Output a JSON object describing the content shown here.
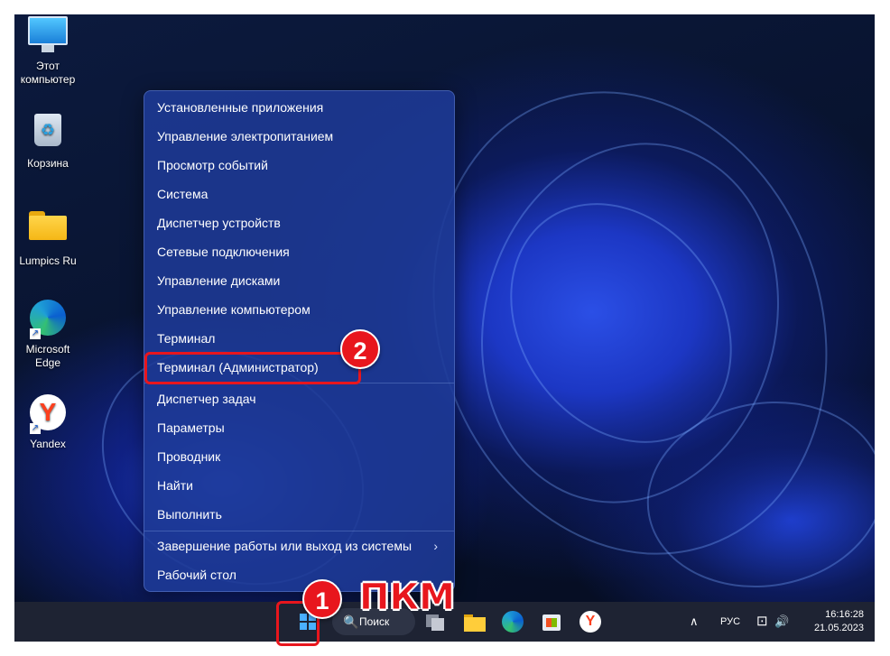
{
  "desktop": {
    "icons": [
      {
        "label_line1": "Этот",
        "label_line2": "компьютер",
        "icon": "this-pc-icon"
      },
      {
        "label_line1": "Корзина",
        "label_line2": "",
        "icon": "recycle-bin-icon"
      },
      {
        "label_line1": "Lumpics Ru",
        "label_line2": "",
        "icon": "folder-icon"
      },
      {
        "label_line1": "Microsoft",
        "label_line2": "Edge",
        "icon": "edge-icon"
      },
      {
        "label_line1": "Yandex",
        "label_line2": "",
        "icon": "yandex-icon"
      }
    ]
  },
  "context_menu": {
    "group1": [
      "Установленные приложения",
      "Управление электропитанием",
      "Просмотр событий",
      "Система",
      "Диспетчер устройств",
      "Сетевые подключения",
      "Управление дисками",
      "Управление компьютером",
      "Терминал",
      "Терминал (Администратор)"
    ],
    "group2": [
      "Диспетчер задач",
      "Параметры",
      "Проводник",
      "Найти",
      "Выполнить"
    ],
    "group3": [
      "Завершение работы или выход из системы",
      "Рабочий стол"
    ],
    "submenu_chevron": "›"
  },
  "annotations": {
    "step1": "1",
    "step2": "2",
    "pkm": "ПКМ",
    "color": "#e8161d"
  },
  "taskbar": {
    "search_label": "Поиск",
    "search_glyph": "🔍",
    "tray_chevron": "∧",
    "language": "РУС",
    "network_glyph": "⊡",
    "volume_glyph": "🔊",
    "time": "16:16:28",
    "date": "21.05.2023",
    "yandex_glyph": "Y",
    "accent": "#4ab0ff"
  }
}
